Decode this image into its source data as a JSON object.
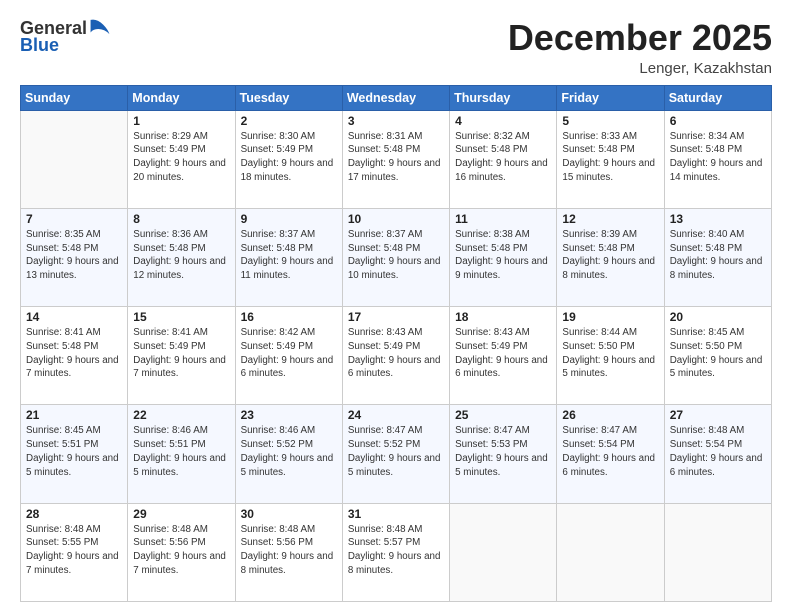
{
  "logo": {
    "general": "General",
    "blue": "Blue"
  },
  "header": {
    "month": "December 2025",
    "location": "Lenger, Kazakhstan"
  },
  "days_of_week": [
    "Sunday",
    "Monday",
    "Tuesday",
    "Wednesday",
    "Thursday",
    "Friday",
    "Saturday"
  ],
  "weeks": [
    [
      {
        "day": "",
        "sunrise": "",
        "sunset": "",
        "daylight": ""
      },
      {
        "day": "1",
        "sunrise": "Sunrise: 8:29 AM",
        "sunset": "Sunset: 5:49 PM",
        "daylight": "Daylight: 9 hours and 20 minutes."
      },
      {
        "day": "2",
        "sunrise": "Sunrise: 8:30 AM",
        "sunset": "Sunset: 5:49 PM",
        "daylight": "Daylight: 9 hours and 18 minutes."
      },
      {
        "day": "3",
        "sunrise": "Sunrise: 8:31 AM",
        "sunset": "Sunset: 5:48 PM",
        "daylight": "Daylight: 9 hours and 17 minutes."
      },
      {
        "day": "4",
        "sunrise": "Sunrise: 8:32 AM",
        "sunset": "Sunset: 5:48 PM",
        "daylight": "Daylight: 9 hours and 16 minutes."
      },
      {
        "day": "5",
        "sunrise": "Sunrise: 8:33 AM",
        "sunset": "Sunset: 5:48 PM",
        "daylight": "Daylight: 9 hours and 15 minutes."
      },
      {
        "day": "6",
        "sunrise": "Sunrise: 8:34 AM",
        "sunset": "Sunset: 5:48 PM",
        "daylight": "Daylight: 9 hours and 14 minutes."
      }
    ],
    [
      {
        "day": "7",
        "sunrise": "Sunrise: 8:35 AM",
        "sunset": "Sunset: 5:48 PM",
        "daylight": "Daylight: 9 hours and 13 minutes."
      },
      {
        "day": "8",
        "sunrise": "Sunrise: 8:36 AM",
        "sunset": "Sunset: 5:48 PM",
        "daylight": "Daylight: 9 hours and 12 minutes."
      },
      {
        "day": "9",
        "sunrise": "Sunrise: 8:37 AM",
        "sunset": "Sunset: 5:48 PM",
        "daylight": "Daylight: 9 hours and 11 minutes."
      },
      {
        "day": "10",
        "sunrise": "Sunrise: 8:37 AM",
        "sunset": "Sunset: 5:48 PM",
        "daylight": "Daylight: 9 hours and 10 minutes."
      },
      {
        "day": "11",
        "sunrise": "Sunrise: 8:38 AM",
        "sunset": "Sunset: 5:48 PM",
        "daylight": "Daylight: 9 hours and 9 minutes."
      },
      {
        "day": "12",
        "sunrise": "Sunrise: 8:39 AM",
        "sunset": "Sunset: 5:48 PM",
        "daylight": "Daylight: 9 hours and 8 minutes."
      },
      {
        "day": "13",
        "sunrise": "Sunrise: 8:40 AM",
        "sunset": "Sunset: 5:48 PM",
        "daylight": "Daylight: 9 hours and 8 minutes."
      }
    ],
    [
      {
        "day": "14",
        "sunrise": "Sunrise: 8:41 AM",
        "sunset": "Sunset: 5:48 PM",
        "daylight": "Daylight: 9 hours and 7 minutes."
      },
      {
        "day": "15",
        "sunrise": "Sunrise: 8:41 AM",
        "sunset": "Sunset: 5:49 PM",
        "daylight": "Daylight: 9 hours and 7 minutes."
      },
      {
        "day": "16",
        "sunrise": "Sunrise: 8:42 AM",
        "sunset": "Sunset: 5:49 PM",
        "daylight": "Daylight: 9 hours and 6 minutes."
      },
      {
        "day": "17",
        "sunrise": "Sunrise: 8:43 AM",
        "sunset": "Sunset: 5:49 PM",
        "daylight": "Daylight: 9 hours and 6 minutes."
      },
      {
        "day": "18",
        "sunrise": "Sunrise: 8:43 AM",
        "sunset": "Sunset: 5:49 PM",
        "daylight": "Daylight: 9 hours and 6 minutes."
      },
      {
        "day": "19",
        "sunrise": "Sunrise: 8:44 AM",
        "sunset": "Sunset: 5:50 PM",
        "daylight": "Daylight: 9 hours and 5 minutes."
      },
      {
        "day": "20",
        "sunrise": "Sunrise: 8:45 AM",
        "sunset": "Sunset: 5:50 PM",
        "daylight": "Daylight: 9 hours and 5 minutes."
      }
    ],
    [
      {
        "day": "21",
        "sunrise": "Sunrise: 8:45 AM",
        "sunset": "Sunset: 5:51 PM",
        "daylight": "Daylight: 9 hours and 5 minutes."
      },
      {
        "day": "22",
        "sunrise": "Sunrise: 8:46 AM",
        "sunset": "Sunset: 5:51 PM",
        "daylight": "Daylight: 9 hours and 5 minutes."
      },
      {
        "day": "23",
        "sunrise": "Sunrise: 8:46 AM",
        "sunset": "Sunset: 5:52 PM",
        "daylight": "Daylight: 9 hours and 5 minutes."
      },
      {
        "day": "24",
        "sunrise": "Sunrise: 8:47 AM",
        "sunset": "Sunset: 5:52 PM",
        "daylight": "Daylight: 9 hours and 5 minutes."
      },
      {
        "day": "25",
        "sunrise": "Sunrise: 8:47 AM",
        "sunset": "Sunset: 5:53 PM",
        "daylight": "Daylight: 9 hours and 5 minutes."
      },
      {
        "day": "26",
        "sunrise": "Sunrise: 8:47 AM",
        "sunset": "Sunset: 5:54 PM",
        "daylight": "Daylight: 9 hours and 6 minutes."
      },
      {
        "day": "27",
        "sunrise": "Sunrise: 8:48 AM",
        "sunset": "Sunset: 5:54 PM",
        "daylight": "Daylight: 9 hours and 6 minutes."
      }
    ],
    [
      {
        "day": "28",
        "sunrise": "Sunrise: 8:48 AM",
        "sunset": "Sunset: 5:55 PM",
        "daylight": "Daylight: 9 hours and 7 minutes."
      },
      {
        "day": "29",
        "sunrise": "Sunrise: 8:48 AM",
        "sunset": "Sunset: 5:56 PM",
        "daylight": "Daylight: 9 hours and 7 minutes."
      },
      {
        "day": "30",
        "sunrise": "Sunrise: 8:48 AM",
        "sunset": "Sunset: 5:56 PM",
        "daylight": "Daylight: 9 hours and 8 minutes."
      },
      {
        "day": "31",
        "sunrise": "Sunrise: 8:48 AM",
        "sunset": "Sunset: 5:57 PM",
        "daylight": "Daylight: 9 hours and 8 minutes."
      },
      {
        "day": "",
        "sunrise": "",
        "sunset": "",
        "daylight": ""
      },
      {
        "day": "",
        "sunrise": "",
        "sunset": "",
        "daylight": ""
      },
      {
        "day": "",
        "sunrise": "",
        "sunset": "",
        "daylight": ""
      }
    ]
  ]
}
